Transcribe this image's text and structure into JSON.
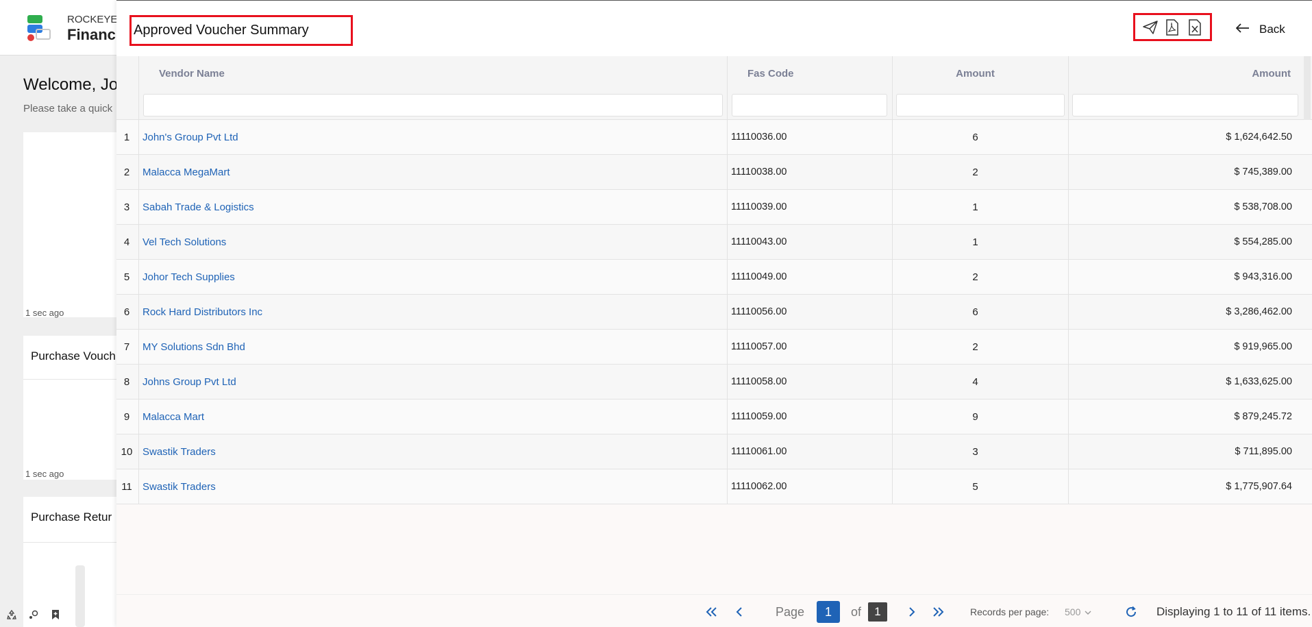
{
  "background": {
    "brand_line1": "ROCKEYE",
    "brand_line2": "Financ",
    "welcome": "Welcome, Jo",
    "subtitle": "Please take a quick",
    "card1_ago": "1 sec ago",
    "card2_title": "Purchase Vouch",
    "card2_ago": "1 sec ago",
    "card3_title": "Purchase Retur"
  },
  "panel": {
    "title": "Approved Voucher Summary",
    "back_label": "Back",
    "actions": [
      "send-icon",
      "pdf-icon",
      "excel-icon"
    ]
  },
  "grid": {
    "columns": [
      "Vendor Name",
      "Fas Code",
      "Amount",
      "Amount"
    ],
    "rows": [
      {
        "idx": "1",
        "vendor": "John's Group Pvt Ltd",
        "fas": "11110036.00",
        "count": "6",
        "amount": "$ 1,624,642.50"
      },
      {
        "idx": "2",
        "vendor": "Malacca MegaMart",
        "fas": "11110038.00",
        "count": "2",
        "amount": "$ 745,389.00"
      },
      {
        "idx": "3",
        "vendor": "Sabah Trade & Logistics",
        "fas": "11110039.00",
        "count": "1",
        "amount": "$ 538,708.00"
      },
      {
        "idx": "4",
        "vendor": "Vel Tech Solutions",
        "fas": "11110043.00",
        "count": "1",
        "amount": "$ 554,285.00"
      },
      {
        "idx": "5",
        "vendor": "Johor Tech Supplies",
        "fas": "11110049.00",
        "count": "2",
        "amount": "$ 943,316.00"
      },
      {
        "idx": "6",
        "vendor": "Rock Hard Distributors Inc",
        "fas": "11110056.00",
        "count": "6",
        "amount": "$ 3,286,462.00"
      },
      {
        "idx": "7",
        "vendor": "MY Solutions Sdn Bhd",
        "fas": "11110057.00",
        "count": "2",
        "amount": "$ 919,965.00"
      },
      {
        "idx": "8",
        "vendor": "Johns Group Pvt Ltd",
        "fas": "11110058.00",
        "count": "4",
        "amount": "$ 1,633,625.00"
      },
      {
        "idx": "9",
        "vendor": "Malacca Mart",
        "fas": "11110059.00",
        "count": "9",
        "amount": "$ 879,245.72"
      },
      {
        "idx": "10",
        "vendor": "Swastik Traders",
        "fas": "11110061.00",
        "count": "3",
        "amount": "$ 711,895.00"
      },
      {
        "idx": "11",
        "vendor": "Swastik Traders",
        "fas": "11110062.00",
        "count": "5",
        "amount": "$ 1,775,907.64"
      }
    ]
  },
  "pager": {
    "page_label": "Page",
    "current_page": "1",
    "of_label": "of",
    "total_pages": "1",
    "records_label": "Records per page:",
    "records_value": "500",
    "display_text": "Displaying 1 to 11 of 11 items."
  },
  "colors": {
    "accent": "#1f63b6",
    "highlight": "#e8101d"
  }
}
